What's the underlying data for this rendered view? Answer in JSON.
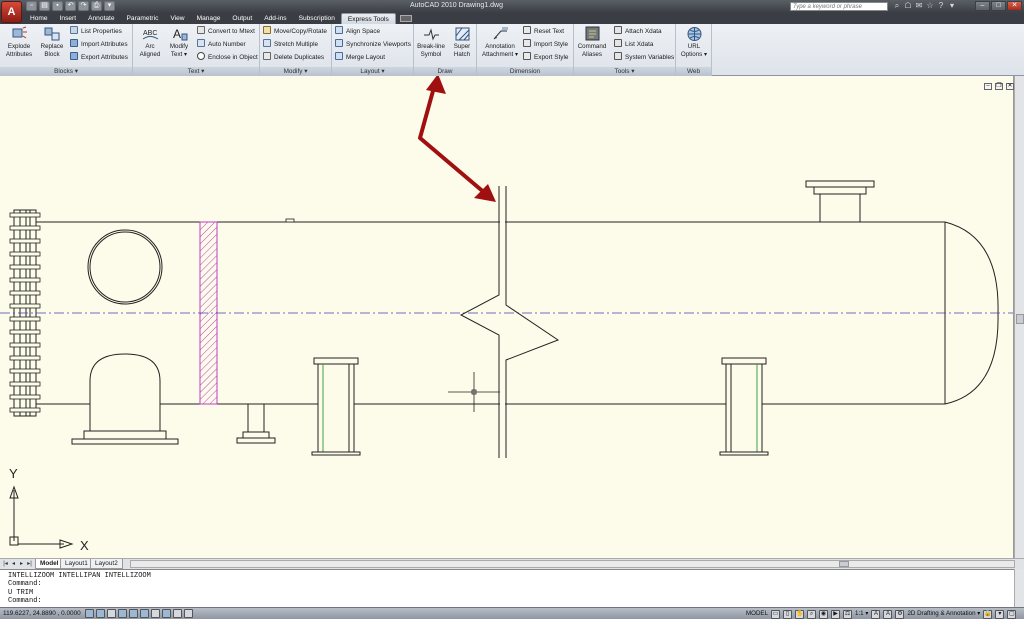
{
  "window": {
    "app_letter": "A",
    "title": "AutoCAD 2010     Drawing1.dwg",
    "search_placeholder": "Type a keyword or phrase",
    "controls": [
      "–",
      "□",
      "✕"
    ]
  },
  "ribbon_tabs": [
    {
      "label": "Home"
    },
    {
      "label": "Insert"
    },
    {
      "label": "Annotate"
    },
    {
      "label": "Parametric"
    },
    {
      "label": "View"
    },
    {
      "label": "Manage"
    },
    {
      "label": "Output"
    },
    {
      "label": "Add-ins"
    },
    {
      "label": "Subscription"
    },
    {
      "label": "Express Tools",
      "active": true
    }
  ],
  "panels": {
    "blocks": {
      "title": "Blocks ▾",
      "explode_attributes": [
        "Explode",
        "Attributes"
      ],
      "replace_block": [
        "Replace",
        "Block"
      ],
      "list_properties": "List Properties",
      "import_attributes": "Import Attributes",
      "export_attributes": "Export Attributes"
    },
    "text": {
      "title": "Text ▾",
      "arc_aligned": [
        "Arc",
        "Aligned"
      ],
      "modify_text": [
        "Modify",
        "Text ▾"
      ],
      "convert_to_mtext": "Convert to Mtext",
      "auto_number": "Auto Number",
      "enclose_in_object": "Enclose in Object"
    },
    "modify": {
      "title": "Modify ▾",
      "move_copy_rotate": "Move/Copy/Rotate",
      "stretch_multiple": "Stretch Multiple",
      "delete_duplicates": "Delete Duplicates"
    },
    "layout": {
      "title": "Layout ▾",
      "align_space": "Align Space",
      "synchronize_viewports": "Synchronize Viewports",
      "merge_layout": "Merge Layout"
    },
    "draw": {
      "title": "Draw",
      "break_line_symbol": [
        "Break-line",
        "Symbol"
      ],
      "super_hatch": [
        "Super",
        "Hatch"
      ]
    },
    "dimension": {
      "title": "Dimension",
      "annotation_attachment": [
        "Annotation",
        "Attachment ▾"
      ],
      "reset_text": "Reset Text",
      "import_style": "Import Style",
      "export_style": "Export Style"
    },
    "tools": {
      "title": "Tools ▾",
      "command_aliases": [
        "Command",
        "Aliases"
      ],
      "attach_xdata": "Attach Xdata",
      "list_xdata": "List Xdata",
      "system_variables": "System Variables"
    },
    "web": {
      "title": "Web",
      "url_options": [
        "URL",
        "Options ▾"
      ]
    }
  },
  "ucs": {
    "x_label": "X",
    "y_label": "Y"
  },
  "layout_tabs": [
    {
      "label": "Model",
      "active": true
    },
    {
      "label": "Layout1"
    },
    {
      "label": "Layout2"
    }
  ],
  "command_history": [
    "INTELLIZOOM INTELLIPAN INTELLIZOOM",
    "Command:",
    "U TRIM",
    "Command:"
  ],
  "status": {
    "coordinates": "119.6227, 24.8890 , 0.0000",
    "model_label": "MODEL",
    "annotation_scale": "1:1 ▾",
    "workspace": "2D Drafting & Annotation ▾"
  },
  "colors": {
    "canvas_bg": "#fdfcea",
    "arrow_red": "#a01010",
    "hatch_magenta": "#c040c0",
    "centerline_blue": "#4040b0",
    "support_green": "#40a040"
  }
}
